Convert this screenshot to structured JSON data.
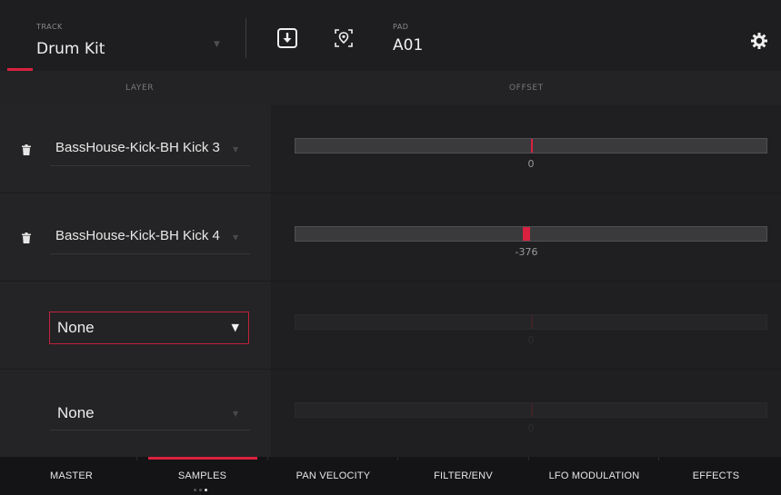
{
  "header": {
    "track_label": "TRACK",
    "track_value": "Drum Kit",
    "pad_label": "PAD",
    "pad_value": "A01",
    "icons": {
      "save": "download-icon",
      "locate": "map-pin-icon",
      "settings": "gear-icon"
    }
  },
  "columns": {
    "layer": "LAYER",
    "offset": "OFFSET"
  },
  "layers": [
    {
      "sample": "BassHouse-Kick-BH Kick 3",
      "offset": "0",
      "offset_fraction": 0.5,
      "has_trash": true
    },
    {
      "sample": "BassHouse-Kick-BH Kick 4",
      "offset": "-376",
      "offset_fraction": 0.49,
      "has_trash": true
    },
    {
      "sample": "None",
      "offset": "0",
      "offset_fraction": 0.5,
      "has_trash": false,
      "selected": true
    },
    {
      "sample": "None",
      "offset": "0",
      "offset_fraction": 0.5,
      "has_trash": false
    }
  ],
  "tabs": [
    {
      "label": "MASTER"
    },
    {
      "label": "SAMPLES",
      "active": true
    },
    {
      "label": "PAN VELOCITY"
    },
    {
      "label": "FILTER/ENV"
    },
    {
      "label": "LFO MODULATION"
    },
    {
      "label": "EFFECTS"
    }
  ],
  "colors": {
    "accent": "#d9213f",
    "background": "#1c1c1e"
  }
}
